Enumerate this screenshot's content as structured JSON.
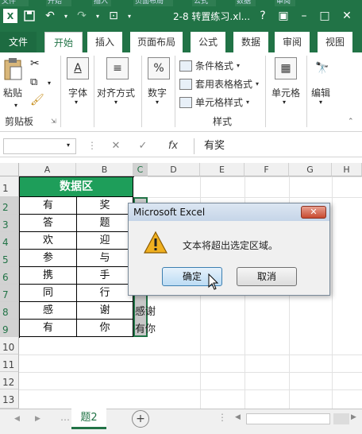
{
  "titlebar": {
    "title": "2-8 转置练习.xl...",
    "app_icon": "excel-logo-icon",
    "ghost_tabs": [
      "文件",
      "开始",
      "插入",
      "页面布局",
      "公式",
      "数据",
      "审阅"
    ]
  },
  "tabs": [
    {
      "label": "文件"
    },
    {
      "label": "开始"
    },
    {
      "label": "插入"
    },
    {
      "label": "页面布局"
    },
    {
      "label": "公式"
    },
    {
      "label": "数据"
    },
    {
      "label": "审阅"
    },
    {
      "label": "视图"
    }
  ],
  "ribbon": {
    "clipboard": {
      "paste": "粘贴",
      "group": "剪贴板"
    },
    "font": "字体",
    "alignment": "对齐方式",
    "number": "数字",
    "number_symbol": "%",
    "styles": {
      "conditional": "条件格式",
      "table": "套用表格格式",
      "cell_styles": "单元格样式",
      "group": "样式"
    },
    "cells": "单元格",
    "editing": "编辑"
  },
  "formula_bar": {
    "fx": "fx",
    "value": "有奖"
  },
  "columns": [
    "A",
    "B",
    "C",
    "D",
    "E",
    "F",
    "G",
    "H"
  ],
  "rows": [
    "1",
    "2",
    "3",
    "4",
    "5",
    "6",
    "7",
    "8",
    "9",
    "10",
    "11",
    "12",
    "13"
  ],
  "table": {
    "header": "数据区",
    "colA": [
      "有",
      "答",
      "欢",
      "参",
      "携",
      "同",
      "感",
      "有"
    ],
    "colB": [
      "奖",
      "题",
      "迎",
      "与",
      "手",
      "行",
      "谢",
      "你"
    ]
  },
  "overflow_text": [
    "感谢",
    "有你"
  ],
  "sheet": {
    "tab": "题2"
  },
  "dialog": {
    "title": "Microsoft Excel",
    "message": "文本将超出选定区域。",
    "ok": "确定",
    "cancel": "取消"
  },
  "colors": {
    "excel_green": "#217346",
    "header_fill": "#1e9e5a"
  }
}
